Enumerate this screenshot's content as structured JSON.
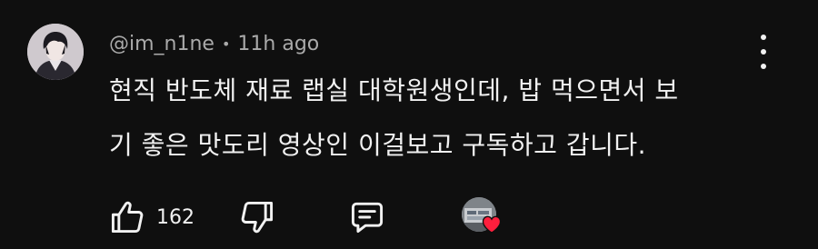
{
  "comment": {
    "author": "@im_n1ne",
    "separator": "•",
    "timestamp": "11h ago",
    "text_lines": [
      "현직 반도체 재료 랩실 대학원생인데, 밥 먹으면서 보",
      "기 좋은 맛도리 영상인 이걸보고 구독하고 갑니다."
    ]
  },
  "actions": {
    "like_count": "162"
  },
  "icons": {
    "avatar": "user-avatar",
    "menu": "more-vertical-icon",
    "like": "thumb-up-icon",
    "dislike": "thumb-down-icon",
    "reply": "reply-icon",
    "creator_heart": "creator-heart-icon"
  },
  "colors": {
    "background": "#0f0f0f",
    "text_primary": "#f1f1f1",
    "text_secondary": "#aaaaaa",
    "heart": "#ff1f3d"
  }
}
